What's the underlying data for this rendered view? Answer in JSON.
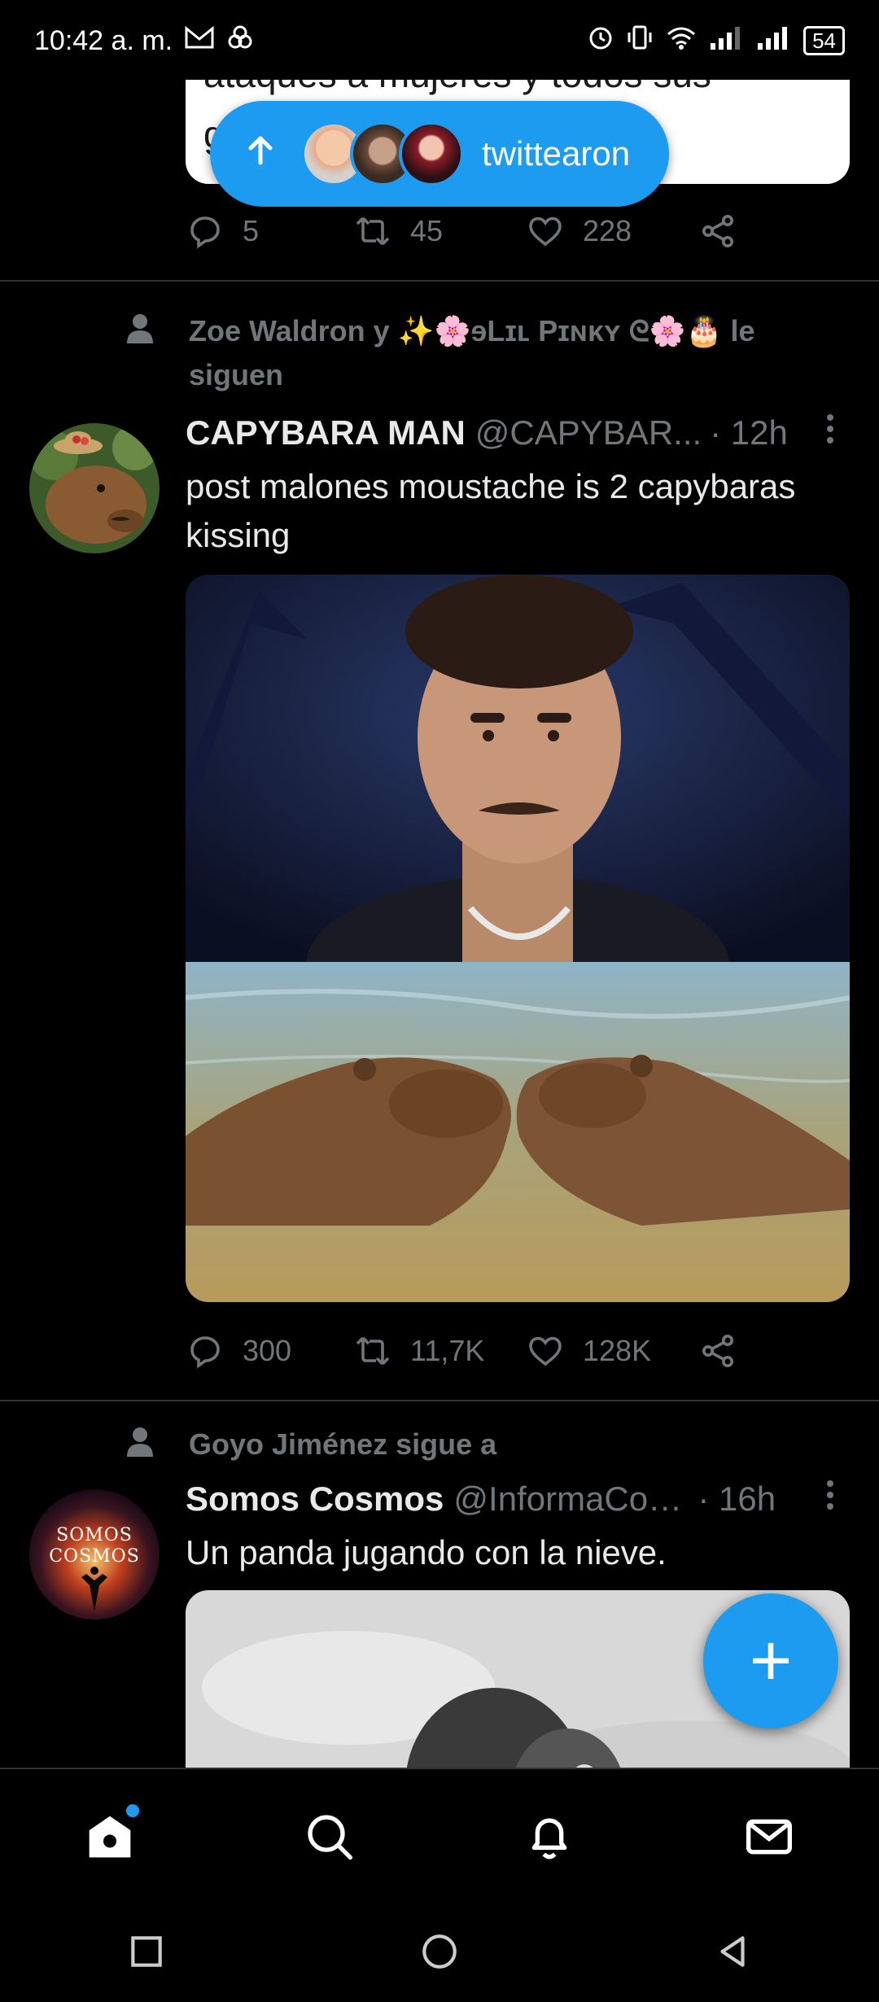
{
  "status_bar": {
    "time": "10:42 a. m.",
    "battery": "54"
  },
  "previous_tweet": {
    "quote_text_partial": "ataques a mujeres y todos sus",
    "quote_text_line2": "g",
    "new_tweets_label": "twittearon",
    "actions": {
      "replies": "5",
      "retweets": "45",
      "likes": "228"
    }
  },
  "tweets": [
    {
      "context": "Zoe Waldron y ✨🌸ɘLɪʟ Pɪɴᴋʏ ᘓ🌸🎂 le siguen",
      "name": "CAPYBARA MAN",
      "handle": "@CAPYBAR...",
      "time": "· 12h",
      "text": "post malones moustache is 2 capybaras kissing",
      "actions": {
        "replies": "300",
        "retweets": "11,7K",
        "likes": "128K"
      }
    },
    {
      "context": "Goyo Jiménez sigue a",
      "name": "Somos Cosmos",
      "handle": "@InformaCos...",
      "time": "· 16h",
      "text": "Un panda jugando con la nieve.",
      "avatar_text_1": "SOMOS",
      "avatar_text_2": "COSMOS"
    }
  ],
  "fab": {
    "label": "+"
  },
  "icons": {
    "home": "home-icon",
    "search": "search-icon",
    "notifications": "bell-icon",
    "messages": "mail-icon"
  },
  "colors": {
    "accent": "#1d9bf0",
    "background": "#000000",
    "secondary_text": "#71767b"
  }
}
